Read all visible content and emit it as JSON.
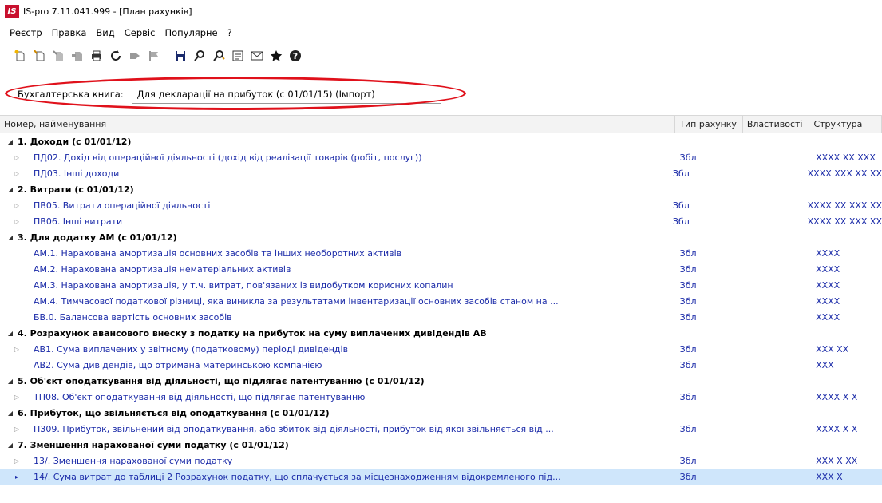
{
  "window": {
    "logo_text": "IS",
    "title": "IS-pro 7.11.041.999 - [План рахунків]"
  },
  "menu": [
    "Реєстр",
    "Правка",
    "Вид",
    "Сервіс",
    "Популярне",
    "?"
  ],
  "toolbar": {
    "icons": [
      "new-doc-icon",
      "copy-doc-icon",
      "edit-doc-icon",
      "delete-icon",
      "print-icon",
      "refresh-icon",
      "move-icon",
      "flag-icon",
      "save-icon",
      "search-icon",
      "find-next-icon",
      "form-icon",
      "mail-icon",
      "star-icon",
      "help-icon"
    ]
  },
  "book": {
    "label": "Бухгалтерська книга:",
    "value": "Для декларації на прибуток (с 01/01/15) (Імпорт)"
  },
  "grid": {
    "headers": {
      "name": "Номер, найменування",
      "type": "Тип рахунку",
      "props": "Властивості",
      "struct": "Структура"
    },
    "rows": [
      {
        "kind": "group",
        "name": "1. Доходи (с 01/01/12)",
        "type": "",
        "struct": ""
      },
      {
        "kind": "child",
        "name": "ПД02. Дохід від операційної діяльності (дохід від реалізації товарів (робіт, послуг))",
        "type": "Збл",
        "struct": "XXXX XX XXX"
      },
      {
        "kind": "child",
        "name": "ПД03. Інші доходи",
        "type": "Збл",
        "struct": "XXXX XXX XX XX"
      },
      {
        "kind": "group",
        "name": "2. Витрати (с 01/01/12)",
        "type": "",
        "struct": ""
      },
      {
        "kind": "child",
        "name": "ПВ05. Витрати операційної діяльності",
        "type": "Збл",
        "struct": "XXXX XX XXX XX"
      },
      {
        "kind": "child",
        "name": "ПВ06. Інші витрати",
        "type": "Збл",
        "struct": "XXXX XX XXX XX"
      },
      {
        "kind": "group",
        "name": "3. Для додатку АМ (с 01/01/12)",
        "type": "",
        "struct": ""
      },
      {
        "kind": "leaf",
        "name": "АМ.1. Нарахована амортизація основних засобів та інших необоротних активів",
        "type": "Збл",
        "struct": "XXXX"
      },
      {
        "kind": "leaf",
        "name": "АМ.2. Нарахована амортизація нематеріальних активів",
        "type": "Збл",
        "struct": "XXXX"
      },
      {
        "kind": "leaf",
        "name": "АМ.3. Нарахована амортизація, у т.ч. витрат, пов'язаних із видобутком корисних копалин",
        "type": "Збл",
        "struct": "XXXX"
      },
      {
        "kind": "leaf",
        "name": "АМ.4. Тимчасової податкової різниці, яка виникла за результатами інвентаризації основних засобів станом на ...",
        "type": "Збл",
        "struct": "XXXX"
      },
      {
        "kind": "leaf",
        "name": "БВ.0. Балансова вартість основних засобів",
        "type": "Збл",
        "struct": "XXXX"
      },
      {
        "kind": "group",
        "name": "4. Розрахунок авансового внеску з податку на прибуток на суму виплачених дивідендів АВ",
        "type": "",
        "struct": ""
      },
      {
        "kind": "child",
        "name": "АВ1. Сума виплачених у звітному (податковому) періоді дивідендів",
        "type": "Збл",
        "struct": "XXX XX"
      },
      {
        "kind": "leaf",
        "name": "АВ2. Сума дивідендів, що отримана материнською компанією",
        "type": "Збл",
        "struct": "XXX"
      },
      {
        "kind": "group",
        "name": "5. Об'єкт оподаткування від діяльності, що підлягає патентуванню (с 01/01/12)",
        "type": "",
        "struct": ""
      },
      {
        "kind": "child",
        "name": "ТП08. Об'єкт оподаткування від діяльності, що підлягає патентуванню",
        "type": "Збл",
        "struct": "XXXX X X"
      },
      {
        "kind": "group",
        "name": "6. Прибуток, що звільняється від оподаткування (с 01/01/12)",
        "type": "",
        "struct": ""
      },
      {
        "kind": "child",
        "name": "ПЗ09. Прибуток, звільнений від оподаткування, або збиток від діяльності, прибуток від якої звільняється від ...",
        "type": "Збл",
        "struct": "XXXX X X"
      },
      {
        "kind": "group",
        "name": "7. Зменшення нарахованої суми податку (с 01/01/12)",
        "type": "",
        "struct": ""
      },
      {
        "kind": "child",
        "name": "13/. Зменшення нарахованої суми податку",
        "type": "Збл",
        "struct": "XXX X XX"
      },
      {
        "kind": "selected",
        "name": "14/. Сума витрат до таблиці 2 Розрахунок податку, що сплачується за місцезнаходженням відокремленого під...",
        "type": "Збл",
        "struct": "XXX X"
      }
    ]
  }
}
